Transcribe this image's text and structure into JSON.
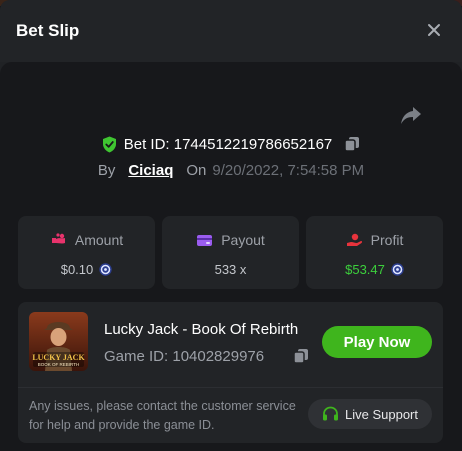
{
  "modal": {
    "title": "Bet Slip"
  },
  "bet": {
    "id_label": "Bet ID: 1744512219786652167",
    "by_label": "By",
    "username": "Ciciaq",
    "on_label": "On",
    "timestamp": "9/20/2022, 7:54:58 PM"
  },
  "stats": [
    {
      "label": "Amount",
      "value": "$0.10",
      "icon": "amount-icon",
      "coin": true
    },
    {
      "label": "Payout",
      "value": "533 x",
      "icon": "payout-icon",
      "coin": false
    },
    {
      "label": "Profit",
      "value": "$53.47",
      "icon": "profit-icon",
      "coin": true
    }
  ],
  "game": {
    "title": "Lucky Jack - Book Of Rebirth",
    "id_label": "Game ID: 10402829976",
    "thumb_text": "LUCKY JACK",
    "thumb_subtext": "BOOK OF REBIRTH",
    "play_label": "Play Now"
  },
  "support": {
    "text": "Any issues, please contact the customer service for help and provide the game ID.",
    "button_label": "Live Support"
  },
  "colors": {
    "accent_green": "#3fb51d",
    "profit_green": "#3ccf3c",
    "amount_pink": "#e8336c",
    "payout_purple": "#9b5cf0",
    "profit_red": "#e8333c",
    "shield_green": "#3fc531"
  }
}
